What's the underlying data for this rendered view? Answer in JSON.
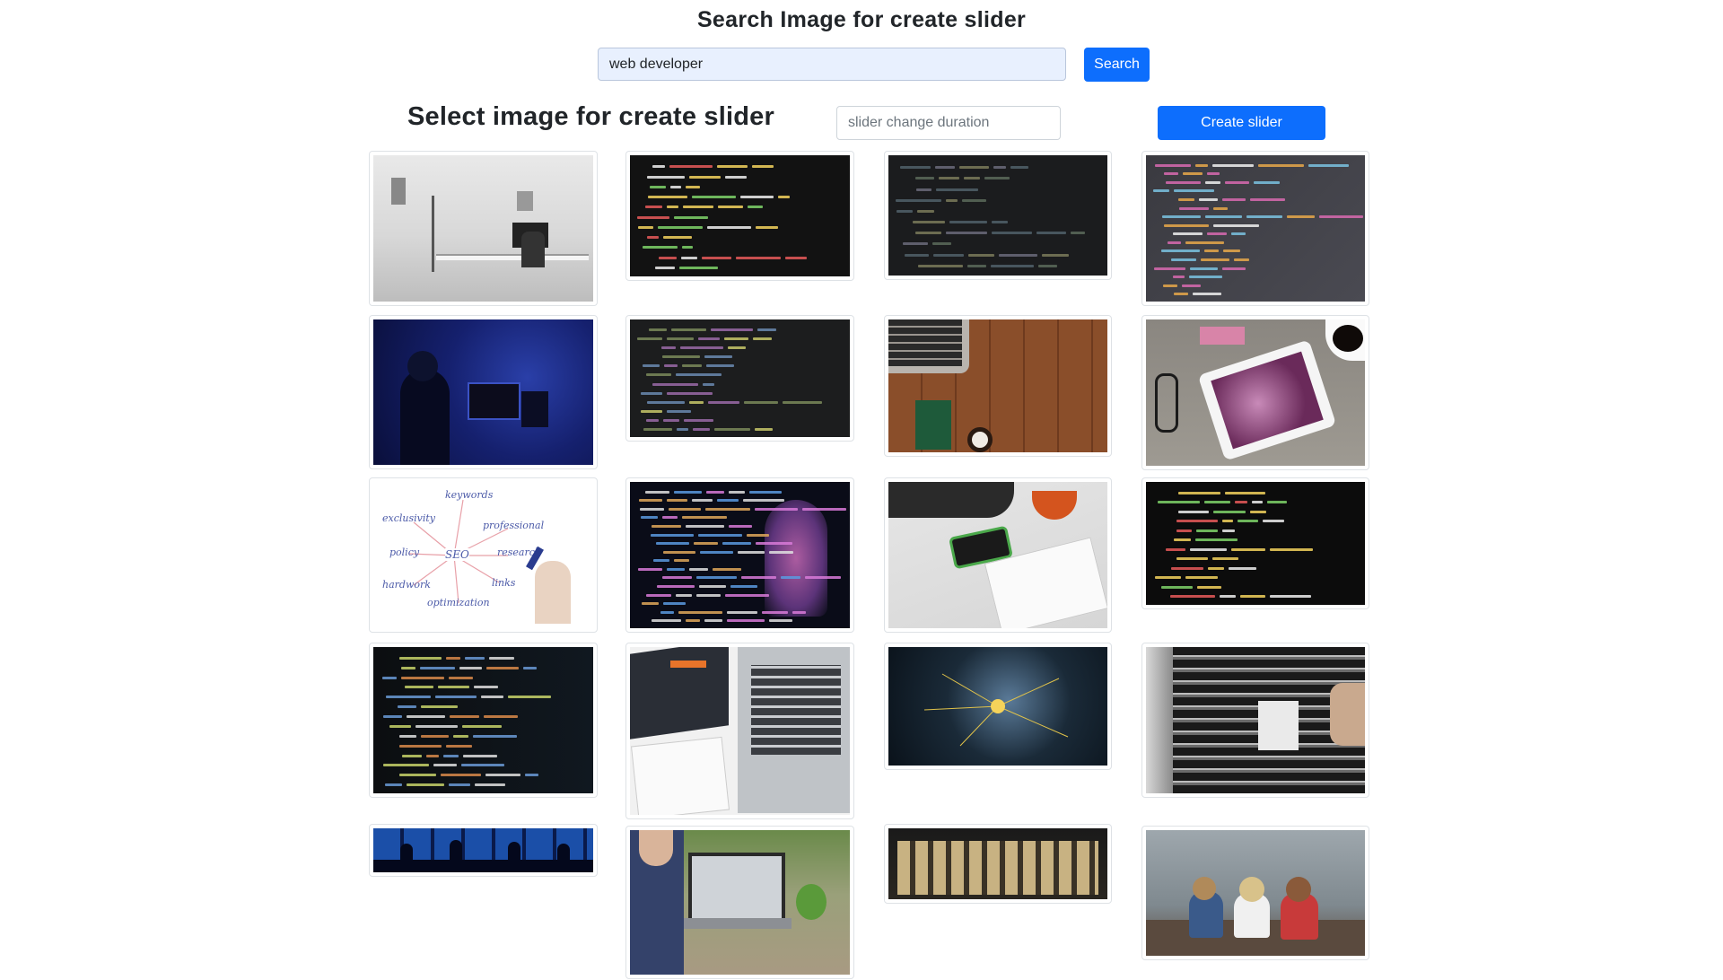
{
  "search": {
    "title": "Search Image for create slider",
    "query": "web developer",
    "button_label": "Search"
  },
  "slider": {
    "title": "Select image for create slider",
    "duration_placeholder": "slider change duration",
    "create_label": "Create slider"
  },
  "images": [
    {
      "subject": "office-bw"
    },
    {
      "subject": "html-code"
    },
    {
      "subject": "dark-editor"
    },
    {
      "subject": "code-screen-angle"
    },
    {
      "subject": "developer-blue-room"
    },
    {
      "subject": "dark-editor-2"
    },
    {
      "subject": "laptop-on-wood"
    },
    {
      "subject": "tablet-glasses-coffee"
    },
    {
      "subject": "seo-whiteboard"
    },
    {
      "subject": "ai-face-code"
    },
    {
      "subject": "phone-notebook-coffee"
    },
    {
      "subject": "html-code-green"
    },
    {
      "subject": "code-line-numbers"
    },
    {
      "subject": "html-css-book-laptop"
    },
    {
      "subject": "touch-network"
    },
    {
      "subject": "server-rack"
    },
    {
      "subject": "silhouettes-banner"
    },
    {
      "subject": "man-laptop"
    },
    {
      "subject": "people-collage"
    },
    {
      "subject": "kids-on-dock"
    }
  ],
  "seo_words": [
    "keywords",
    "exclusivity",
    "professional",
    "policy",
    "SEO",
    "research",
    "hardwork",
    "links",
    "optimization"
  ]
}
